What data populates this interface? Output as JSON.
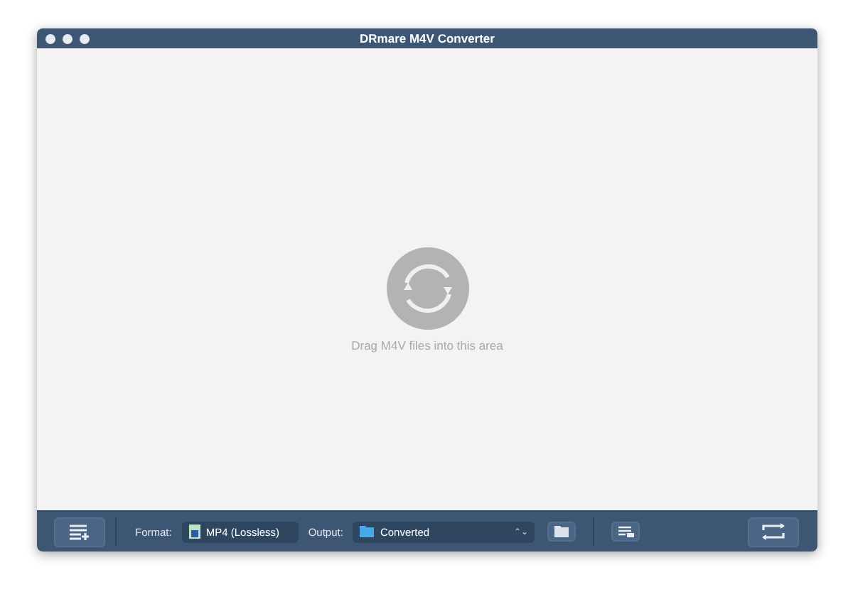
{
  "window": {
    "title": "DRmare M4V Converter"
  },
  "drop_area": {
    "hint": "Drag M4V files into this area"
  },
  "toolbar": {
    "format_label": "Format:",
    "format_value": "MP4 (Lossless)",
    "output_label": "Output:",
    "output_value": "Converted",
    "output_arrows": "⌃⌄"
  }
}
